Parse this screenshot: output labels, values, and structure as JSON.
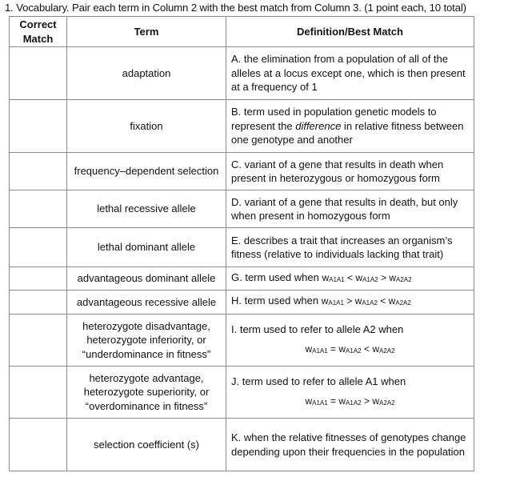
{
  "instructions": "1. Vocabulary. Pair each term in Column 2 with the best match from Column 3. (1 point each, 10 total)",
  "table": {
    "headers": {
      "match": "Correct Match",
      "term": "Term",
      "definition": "Definition/Best Match"
    },
    "rows": [
      {
        "match": "",
        "term": "adaptation",
        "definition": "A. the elimination from a population of all of the alleles at a locus except one, which is then present at a frequency of 1"
      },
      {
        "match": "",
        "term": "fixation",
        "def_pre": "B. term used in population genetic models to represent the ",
        "def_em": "difference",
        "def_post": " in relative fitness between one genotype and another"
      },
      {
        "match": "",
        "term": "frequency–dependent selection",
        "definition": "C. variant of a gene that results in death when present in heterozygous or homozygous form"
      },
      {
        "match": "",
        "term": "lethal recessive allele",
        "definition": "D. variant of a gene that results in death, but only when present in homozygous form"
      },
      {
        "match": "",
        "term": "lethal dominant allele",
        "definition": "E. describes a trait that increases an organism’s fitness (relative to individuals lacking that trait)"
      },
      {
        "match": "",
        "term": "advantageous dominant allele",
        "def_pre": "G.  term used when ",
        "w": "w",
        "s1": "A1A1",
        "op1": " < ",
        "s2": "A1A2",
        "op2": " > ",
        "s3": "A2A2"
      },
      {
        "match": "",
        "term": "advantageous recessive allele",
        "def_pre": "H. term used when ",
        "w": "w",
        "s1": "A1A1",
        "op1": " > ",
        "s2": "A1A2",
        "op2": " < ",
        "s3": "A2A2"
      },
      {
        "match": "",
        "term": "heterozygote disadvantage, heterozygote inferiority, or “underdominance in fitness”",
        "def_pre": "I. term used to refer to allele A2 when",
        "w": "w",
        "s1": "A1A1",
        "op1": " = ",
        "s2": "A1A2",
        "op2": " < ",
        "s3": "A2A2"
      },
      {
        "match": "",
        "term": "heterozygote advantage, heterozygote superiority, or “overdominance in fitness”",
        "def_pre": "J. term used to refer to allele A1 when",
        "w": "w",
        "s1": "A1A1",
        "op1": " = ",
        "s2": "A1A2",
        "op2": " > ",
        "s3": "A2A2"
      },
      {
        "match": "",
        "term": "selection coefficient (s)",
        "definition": "K. when the relative fitnesses of genotypes change depending upon their frequencies in the population"
      }
    ]
  }
}
